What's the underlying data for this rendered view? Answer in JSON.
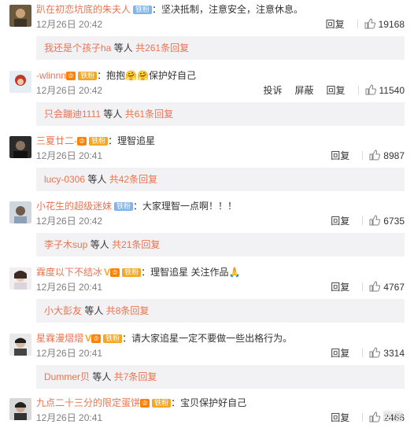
{
  "reply_suffix_people": "等人",
  "reply_word": "回复",
  "colors": {
    "username": "#eb7350",
    "text": "#333333",
    "time": "#808080",
    "reply_bg": "#f2f2f5"
  },
  "comments": [
    {
      "username": "趴在初恋坑底的朱夫人",
      "badges": [
        "铁粉"
      ],
      "text": "坚决抵制，注意安全，注意休息。",
      "time": "12月26日 20:42",
      "actions": [
        "回复"
      ],
      "likes": "19168",
      "reply_name": "我还是个孩子ha",
      "reply_count": "共261条回复"
    },
    {
      "username": "-wlinnn",
      "badges": [
        "铁粉"
      ],
      "text": "抱抱🤗🤗保护好自己",
      "time": "12月26日 20:42",
      "actions": [
        "投诉",
        "屏蔽",
        "回复"
      ],
      "likes": "11540",
      "reply_name": "只会蹦迪1111",
      "reply_count": "共61条回复"
    },
    {
      "username": "三夏廿二-",
      "badges": [
        "铁粉"
      ],
      "text": "理智追星",
      "time": "12月26日 20:41",
      "actions": [
        "回复"
      ],
      "likes": "8987",
      "reply_name": "lucy-0306",
      "reply_count": "共42条回复"
    },
    {
      "username": "小花生的超级迷妹",
      "badges": [
        "铁粉"
      ],
      "text": "大家理智一点啊！！！",
      "time": "12月26日 20:42",
      "actions": [
        "回复"
      ],
      "likes": "6735",
      "reply_name": "李子木sup",
      "reply_count": "共21条回复"
    },
    {
      "username": "霖度以下不结冰",
      "badges": [
        "V",
        "铁粉"
      ],
      "text": "理智追星 关注作品🙏",
      "time": "12月26日 20:41",
      "actions": [
        "回复"
      ],
      "likes": "4767",
      "reply_name": "小大彭友",
      "reply_count": "共8条回复"
    },
    {
      "username": "星霖漫熠熠",
      "badges": [
        "V",
        "铁粉"
      ],
      "text": "请大家追星一定不要做一些出格行为。",
      "time": "12月26日 20:41",
      "actions": [
        "回复"
      ],
      "likes": "3314",
      "reply_name": "Dummer贝",
      "reply_count": "共7条回复"
    },
    {
      "username": "九点二十三分的限定蛋饼",
      "badges": [
        "铁粉"
      ],
      "text": "宝贝保护好自己",
      "time": "12月26日 20:41",
      "actions": [
        "回复"
      ],
      "likes": "2466"
    }
  ],
  "watermark": "百度"
}
